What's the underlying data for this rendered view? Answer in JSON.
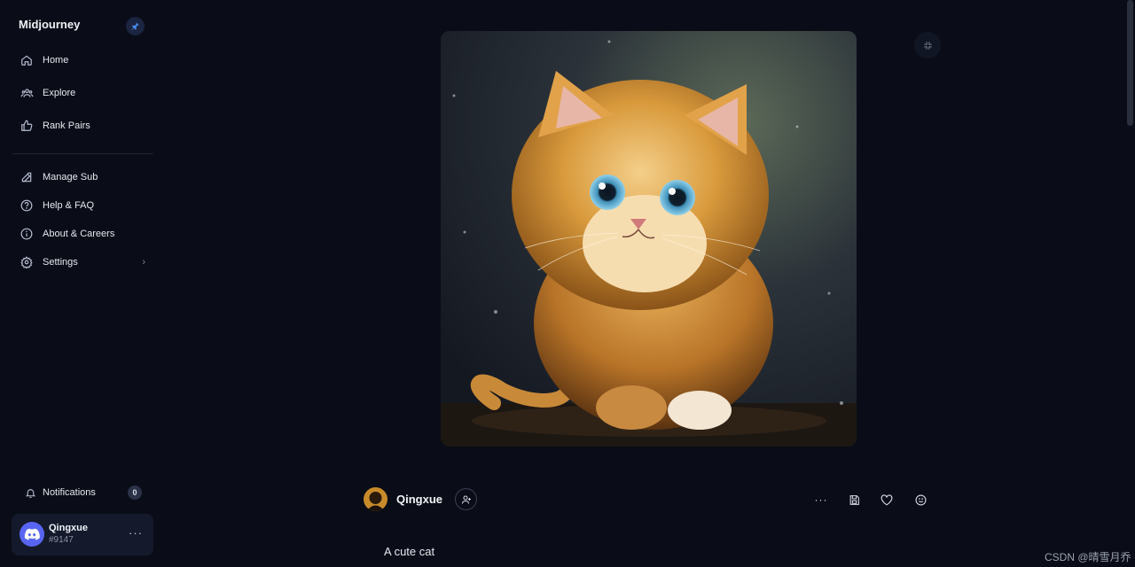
{
  "sidebar": {
    "brand": "Midjourney",
    "nav": [
      {
        "label": "Home",
        "icon": "home-icon"
      },
      {
        "label": "Explore",
        "icon": "explore-icon"
      },
      {
        "label": "Rank Pairs",
        "icon": "thumbs-up-icon"
      },
      {
        "label": "Manage Sub",
        "icon": "edit-icon"
      },
      {
        "label": "Help & FAQ",
        "icon": "help-icon"
      },
      {
        "label": "About & Careers",
        "icon": "info-icon"
      },
      {
        "label": "Settings",
        "icon": "gear-icon"
      }
    ],
    "notifications": {
      "label": "Notifications",
      "count": "0"
    },
    "user": {
      "name": "Qingxue",
      "tag": "#9147"
    }
  },
  "post": {
    "image_alt": "A cute cat",
    "author": "Qingxue",
    "prompt": "A cute cat"
  },
  "watermark": "CSDN @晴雪月乔",
  "colors": {
    "background": "#0a0d17",
    "sidebar_card": "#141a2b",
    "accent": "#5865f2",
    "pin_bg": "#1b2440"
  }
}
